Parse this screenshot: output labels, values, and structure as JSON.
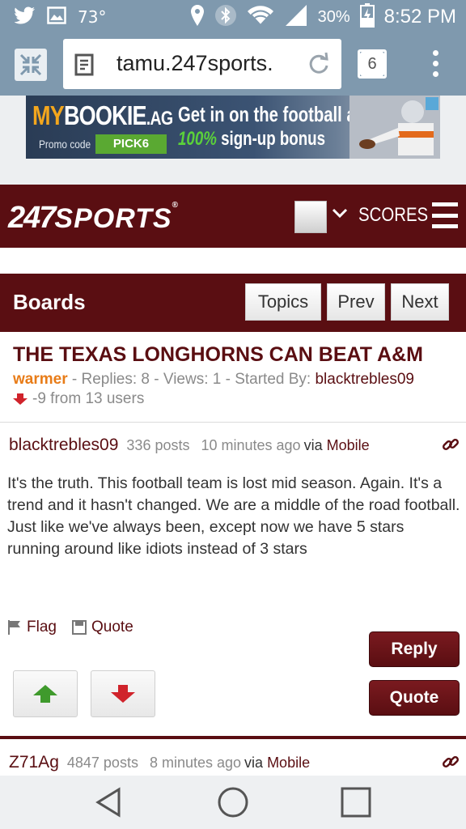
{
  "status_bar": {
    "temperature": "73°",
    "battery_percent": "30%",
    "time": "8:52 PM"
  },
  "browser": {
    "url": "tamu.247sports.",
    "tab_count": "6"
  },
  "ad": {
    "brand_my": "MY",
    "brand_bookie": "BOOKIE",
    "brand_ag": ".AG",
    "promo_label": "Promo code",
    "promo_code": "PICK6",
    "headline": "Get in on the football action",
    "bonus_pct": "100%",
    "bonus_text": "sign-up bonus"
  },
  "header": {
    "logo_num": "247",
    "logo_text": "SPORTS",
    "scores_label": "SCORES"
  },
  "boards_bar": {
    "title": "Boards",
    "topics_label": "Topics",
    "prev_label": "Prev",
    "next_label": "Next"
  },
  "thread": {
    "title": "THE TEXAS LONGHORNS CAN BEAT A&M",
    "tag": "warmer",
    "meta": " - Replies: 8 - Views: 1 - Started By: ",
    "started_by": "blacktrebles09",
    "vote_text": "-9 from 13 users"
  },
  "posts": [
    {
      "user": "blacktrebles09",
      "post_count": "336 posts",
      "time": "10 minutes ago",
      "via": "via",
      "via_source": "Mobile",
      "body": "It's the truth. This football team is lost mid season. Again. It's a trend and it hasn't changed. We are a middle of the road football. Just like we've always been, except now we have 5 stars running around like idiots instead of 3 stars",
      "flag_label": "Flag",
      "quote_link_label": "Quote",
      "reply_label": "Reply",
      "quote_button_label": "Quote"
    },
    {
      "user": "Z71Ag",
      "post_count": "4847 posts",
      "time": "8 minutes ago",
      "via": "via",
      "via_source": "Mobile"
    }
  ],
  "colors": {
    "maroon": "#5a0e12",
    "status_bar": "#7f99ae",
    "warmer_tag": "#e87c18",
    "upvote": "#3f9a2c",
    "downvote": "#d0232b"
  }
}
